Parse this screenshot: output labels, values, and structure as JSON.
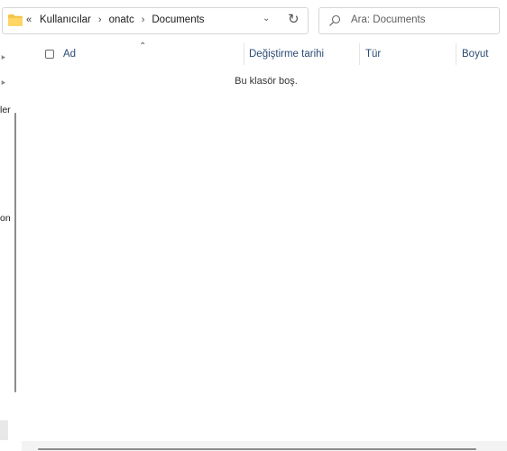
{
  "address": {
    "overflow": "«",
    "crumbs": [
      "Kullanıcılar",
      "onatc",
      "Documents"
    ],
    "separator": "›",
    "dropdown_icon": "chevron-down-icon",
    "refresh_icon": "refresh-icon"
  },
  "search": {
    "placeholder": "Ara: Documents"
  },
  "nav": {
    "fragments": [
      "ler",
      "on"
    ]
  },
  "columns": {
    "name": "Ad",
    "modified": "Değiştirme tarihi",
    "type": "Tür",
    "size": "Boyut"
  },
  "content": {
    "empty_message": "Bu klasör boş."
  },
  "colors": {
    "folder": "#f3c448",
    "header_text": "#2b4b75",
    "border": "#d6d6d6"
  }
}
